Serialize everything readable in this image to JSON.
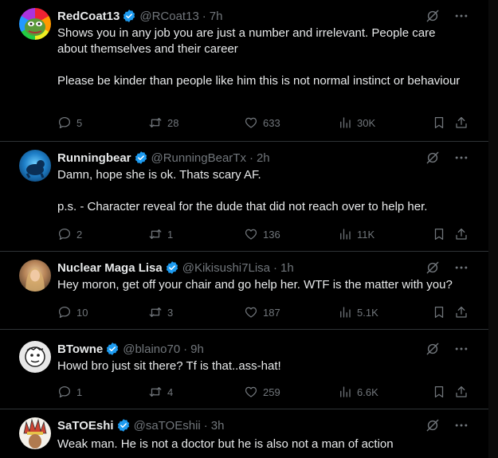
{
  "tweets": [
    {
      "name": "RedCoat13",
      "handle": "@RCoat13",
      "time": "7h",
      "text": "Shows you in any job you are just a number and irrelevant. People care about themselves and their career\n\nPlease be kinder than people like him this is not normal instinct or behaviour",
      "replies": "5",
      "retweets": "28",
      "likes": "633",
      "views": "30K"
    },
    {
      "name": "Runningbear",
      "handle": "@RunningBearTx",
      "time": "2h",
      "text": "Damn, hope she is ok. Thats scary AF.\n\np.s. - Character reveal for the dude that did not reach over to help her.",
      "replies": "2",
      "retweets": "1",
      "likes": "136",
      "views": "11K"
    },
    {
      "name": "Nuclear Maga Lisa",
      "handle": "@Kikisushi7Lisa",
      "time": "1h",
      "text": "Hey moron, get off your chair and go help her. WTF is the matter with you?",
      "replies": "10",
      "retweets": "3",
      "likes": "187",
      "views": "5.1K"
    },
    {
      "name": "BTowne",
      "handle": "@blaino70",
      "time": "9h",
      "text": "Howd bro just sit there? Tf is that..ass-hat!",
      "replies": "1",
      "retweets": "4",
      "likes": "259",
      "views": "6.6K"
    },
    {
      "name": "SaTOEshi",
      "handle": "@saTOEshii",
      "time": "3h",
      "text": "Weak man. He is not a doctor but he is also not a man of action",
      "replies": "",
      "retweets": "",
      "likes": "",
      "views": ""
    }
  ],
  "colors": {
    "background": "#000000",
    "text": "#e7e9ea",
    "muted": "#71767b",
    "verified": "#1d9bf0",
    "divider": "#2f3336"
  }
}
